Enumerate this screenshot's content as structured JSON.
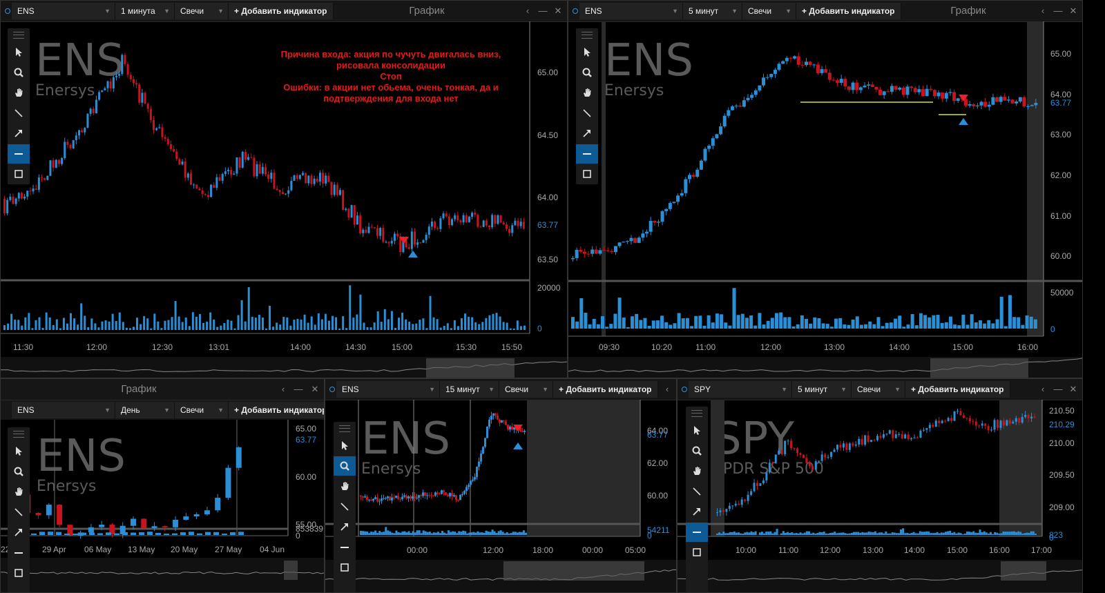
{
  "colors": {
    "up": "#2b8fd6",
    "down": "#c8141e",
    "level": "#a8a826",
    "price_label": "#2b8fd6",
    "active_tool": "#0e5a95"
  },
  "tools": [
    "cursor-icon",
    "zoom-icon",
    "hand-icon",
    "line-icon",
    "arrow-icon",
    "horizontal-line-icon",
    "rectangle-icon"
  ],
  "panels": {
    "p1": {
      "symbol": "ENS",
      "interval": "1 минута",
      "type": "Свечи",
      "add": "+ Добавить индикатор",
      "title": "График",
      "wm_symbol": "ENS",
      "wm_name": "Enersys",
      "note": [
        "Причина входа: акция по чучуть двигалась вниз,",
        "рисовала консолидации",
        "Стоп",
        "Ошибки: в акции нет обьема, очень тонкая, да и",
        "подтверждения для входа нет"
      ],
      "price_ticks": [
        "65.00",
        "64.50",
        "64.00",
        "63.50"
      ],
      "last_price": "63.77",
      "vol_ticks": [
        "20000",
        "0"
      ],
      "time_ticks": [
        "11:30",
        "12:00",
        "12:30",
        "13:01",
        "14:00",
        "14:30",
        "15:00",
        "15:30",
        "15:50"
      ]
    },
    "p2": {
      "symbol": "ENS",
      "interval": "5 минут",
      "type": "Свечи",
      "add": "+ Добавить индикатор",
      "title": "График",
      "wm_symbol": "ENS",
      "wm_name": "Enersys",
      "price_ticks": [
        "65.00",
        "64.00",
        "63.00",
        "62.00",
        "61.00",
        "60.00"
      ],
      "last_price": "63.77",
      "vol_ticks": [
        "50000",
        "0"
      ],
      "time_ticks": [
        "09:30",
        "10:20",
        "11:00",
        "12:00",
        "13:00",
        "14:00",
        "15:00",
        "16:00"
      ]
    },
    "p3": {
      "symbol": "ENS",
      "interval": "День",
      "type": "Свечи",
      "add": "+ Добавить индикатор",
      "title": "График",
      "wm_symbol": "ENS",
      "wm_name": "Enersys",
      "price_ticks": [
        "65.00",
        "60.00",
        "55.00"
      ],
      "last_price": "63.77",
      "vol_ticks": [
        "853839",
        "0"
      ],
      "time_ticks": [
        "22",
        "29 Apr",
        "06 May",
        "13 May",
        "20 May",
        "27 May",
        "04 Jun"
      ]
    },
    "p4": {
      "symbol": "ENS",
      "interval": "15 минут",
      "type": "Свечи",
      "add": "+ Добавить индикатор",
      "wm_symbol": "ENS",
      "wm_name": "Enersys",
      "price_ticks": [
        "64.00",
        "62.00",
        "60.00"
      ],
      "last_price": "63.77",
      "vol_ticks": [
        "54211",
        "0"
      ],
      "time_ticks": [
        "00:00",
        "12:00",
        "18:00",
        "00:00",
        "05:00"
      ]
    },
    "p5": {
      "symbol": "SPY",
      "interval": "5 минут",
      "type": "Свечи",
      "add": "+ Добавить индикатор",
      "wm_symbol": "SPY",
      "wm_name": "SPDR S&P 500",
      "price_ticks": [
        "210.50",
        "210.00",
        "209.50",
        "209.00"
      ],
      "last_price": "210.29",
      "vol_ticks": [
        "823",
        "0"
      ],
      "time_ticks": [
        "10:00",
        "11:00",
        "12:00",
        "13:00",
        "14:00",
        "15:00",
        "16:00",
        "17:00"
      ]
    }
  }
}
